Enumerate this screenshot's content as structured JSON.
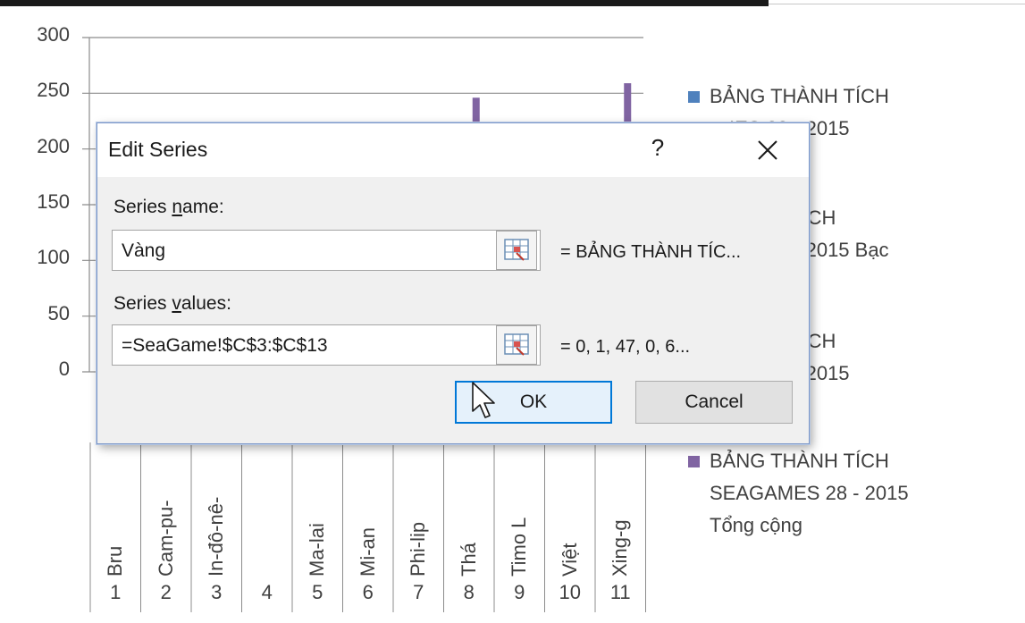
{
  "chart_data": {
    "type": "bar",
    "categories": [
      "Bru",
      "Cam-pu-",
      "In-đô-nê-",
      "",
      "Ma-lai",
      "Mi-an",
      "Phi-lip",
      "Thá",
      "Timo L",
      "Việt",
      "Xing-g"
    ],
    "category_numbers": [
      "1",
      "2",
      "3",
      "4",
      "5",
      "6",
      "7",
      "8",
      "9",
      "10",
      "11"
    ],
    "y_ticks": [
      "300",
      "250",
      "200",
      "150",
      "100",
      "50",
      "0"
    ],
    "ylim": [
      0,
      300
    ],
    "series": [
      {
        "name": "BẢNG THÀNH TÍCH SEAGAMES 28 - 2015 Tổng cộng",
        "color": "#8064a2",
        "values": [
          null,
          null,
          null,
          null,
          null,
          null,
          null,
          246,
          null,
          null,
          259
        ]
      }
    ],
    "legend": [
      {
        "lines": [
          "BẢNG THÀNH TÍCH",
          "…IES 28 - 2015"
        ],
        "color": "#4f81bd"
      },
      {
        "lines": [
          "…HÀNH TÍCH",
          "…IES 28 - 2015 Bạc"
        ],
        "color": "#c0504d"
      },
      {
        "lines": [
          "…HÀNH TÍCH",
          "…IES 28 - 2015"
        ],
        "color": "#9bbb59"
      },
      {
        "lines": [
          "BẢNG THÀNH TÍCH",
          "SEAGAMES 28 - 2015",
          "Tổng cộng"
        ],
        "color": "#8064a2"
      }
    ],
    "grid": true,
    "legend_position": "right"
  },
  "dialog": {
    "title": "Edit Series",
    "help_label": "?",
    "series_name_label_pre": "Series ",
    "series_name_label_u": "n",
    "series_name_label_post": "ame:",
    "series_name_value": "Vàng",
    "series_name_preview": "= BẢNG THÀNH TÍC...",
    "series_values_label_pre": "Series ",
    "series_values_label_u": "v",
    "series_values_label_post": "alues:",
    "series_values_value": "=SeaGame!$C$3:$C$13",
    "series_values_preview": "= 0, 1, 47, 0, 6...",
    "ok_label": "OK",
    "cancel_label": "Cancel"
  }
}
